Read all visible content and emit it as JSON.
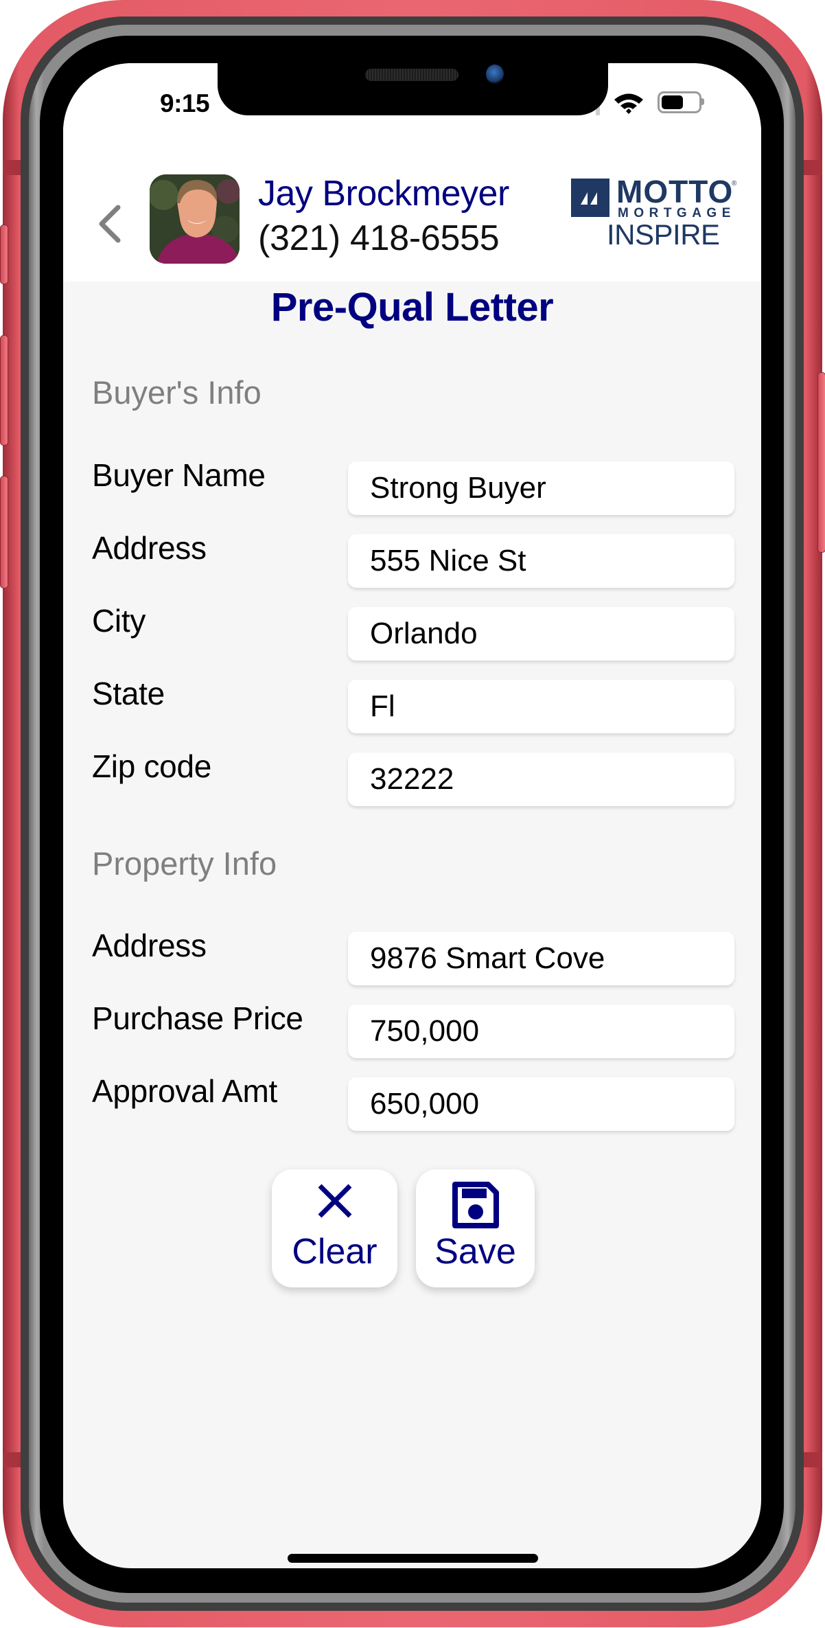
{
  "status_bar": {
    "time": "9:15",
    "battery_level_percent": 60,
    "icons": [
      "signal-icon",
      "wifi-icon",
      "battery-icon"
    ]
  },
  "header": {
    "back_icon": "chevron-left-icon",
    "agent": {
      "name": "Jay Brockmeyer",
      "phone": "(321) 418-6555",
      "avatar": "agent-photo"
    },
    "logo": {
      "line1": "MOTTO",
      "registered": "®",
      "line2": "MORTGAGE",
      "line3": "INSPIRE"
    }
  },
  "colors": {
    "accent": "#000080",
    "section_label": "#7f7f7f",
    "background": "#f6f6f6",
    "logo_navy": "#1f3864",
    "frame": "#e25a65"
  },
  "page": {
    "title": "Pre-Qual Letter"
  },
  "buyer_section": {
    "label": "Buyer's Info",
    "fields": [
      {
        "label": "Buyer Name",
        "value": "Strong Buyer"
      },
      {
        "label": "Address",
        "value": "555 Nice St"
      },
      {
        "label": "City",
        "value": "Orlando"
      },
      {
        "label": "State",
        "value": "Fl"
      },
      {
        "label": "Zip code",
        "value": "32222"
      }
    ]
  },
  "property_section": {
    "label": "Property Info",
    "fields": [
      {
        "label": "Address",
        "value": "9876 Smart Cove"
      },
      {
        "label": "Purchase Price",
        "value": "750,000"
      },
      {
        "label": "Approval Amt",
        "value": "650,000"
      }
    ]
  },
  "actions": {
    "clear": {
      "label": "Clear",
      "icon": "close-icon"
    },
    "save": {
      "label": "Save",
      "icon": "floppy-disk-icon"
    }
  }
}
